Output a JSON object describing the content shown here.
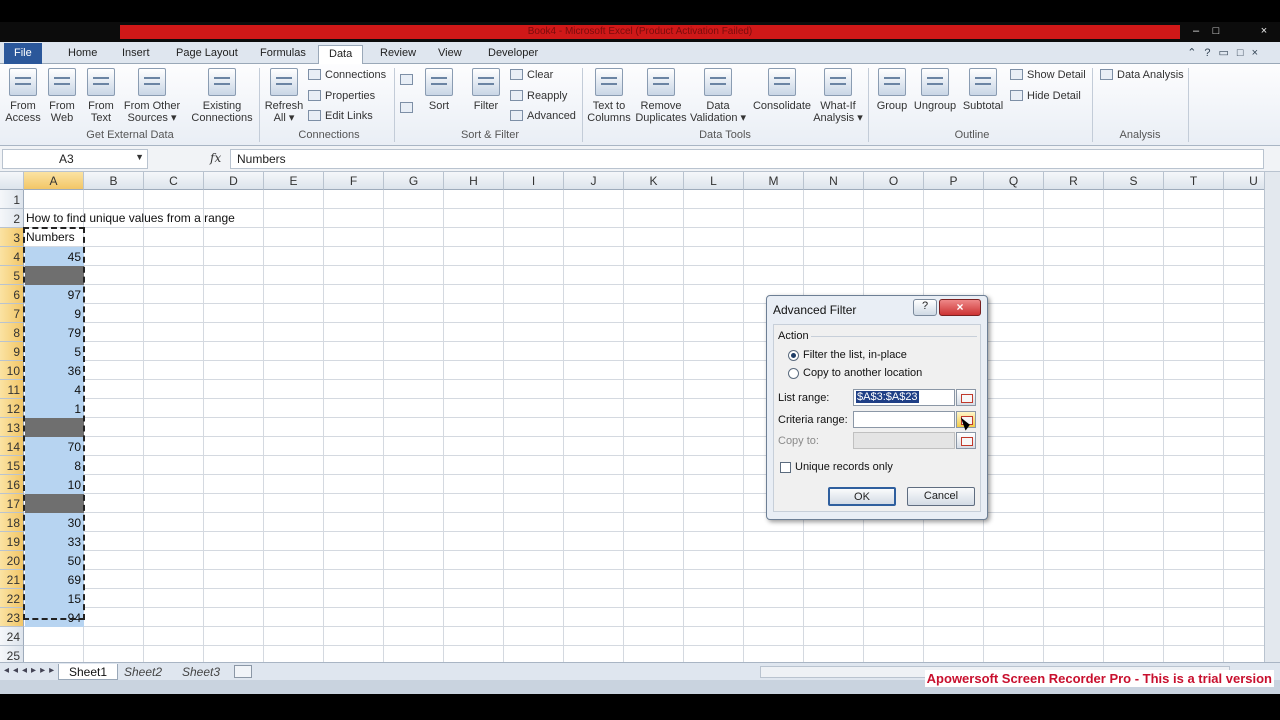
{
  "window": {
    "title": "Book4 - Microsoft Excel (Product Activation Failed)",
    "controls": [
      "–",
      "□",
      "×"
    ]
  },
  "ribbon_tabs": [
    "File",
    "Home",
    "Insert",
    "Page Layout",
    "Formulas",
    "Data",
    "Review",
    "View",
    "Developer"
  ],
  "active_tab": "Data",
  "ribbon": {
    "get_external_data": {
      "label": "Get External Data",
      "from_access": [
        "From",
        "Access"
      ],
      "from_web": [
        "From",
        "Web"
      ],
      "from_text": [
        "From",
        "Text"
      ],
      "from_other": [
        "From Other",
        "Sources ▾"
      ],
      "existing": [
        "Existing",
        "Connections"
      ]
    },
    "connections": {
      "label": "Connections",
      "refresh": [
        "Refresh",
        "All ▾"
      ],
      "items": [
        "Connections",
        "Properties",
        "Edit Links"
      ]
    },
    "sort_filter": {
      "label": "Sort & Filter",
      "sort": "Sort",
      "filter": "Filter",
      "items": [
        "Clear",
        "Reapply",
        "Advanced"
      ]
    },
    "data_tools": {
      "label": "Data Tools",
      "text_to_columns": [
        "Text to",
        "Columns"
      ],
      "remove_duplicates": [
        "Remove",
        "Duplicates"
      ],
      "data_validation": [
        "Data",
        "Validation ▾"
      ],
      "consolidate": "Consolidate",
      "what_if": [
        "What-If",
        "Analysis ▾"
      ]
    },
    "outline": {
      "label": "Outline",
      "group": "Group",
      "ungroup": "Ungroup",
      "subtotal": "Subtotal",
      "items": [
        "Show Detail",
        "Hide Detail"
      ]
    },
    "analysis": {
      "label": "Analysis",
      "data_analysis": "Data Analysis"
    }
  },
  "formula_bar": {
    "name_box": "A3",
    "fx": "fx",
    "content": "Numbers"
  },
  "columns": [
    "A",
    "B",
    "C",
    "D",
    "E",
    "F",
    "G",
    "H",
    "I",
    "J",
    "K",
    "L",
    "M",
    "N",
    "O",
    "P",
    "Q",
    "R",
    "S",
    "T",
    "U"
  ],
  "rows": [
    "1",
    "2",
    "3",
    "4",
    "5",
    "6",
    "7",
    "8",
    "9",
    "10",
    "11",
    "12",
    "13",
    "14",
    "15",
    "16",
    "17",
    "18",
    "19",
    "20",
    "21",
    "22",
    "23",
    "24",
    "25"
  ],
  "cells": {
    "a2": "How to find unique values from a range",
    "a3": "Numbers",
    "values": [
      "45",
      "",
      "97",
      "9",
      "79",
      "5",
      "36",
      "4",
      "1",
      "",
      "70",
      "8",
      "10",
      "",
      "30",
      "33",
      "50",
      "69",
      "15",
      "94"
    ]
  },
  "sheet_tabs": [
    "Sheet1",
    "Sheet2",
    "Sheet3"
  ],
  "watermark": "Apowersoft Screen Recorder Pro - This is a trial version",
  "dialog": {
    "title": "Advanced Filter",
    "help": "?",
    "close": "×",
    "action_label": "Action",
    "radio_filter": "Filter the list, in-place",
    "radio_copy": "Copy to another location",
    "list_range_label": "List range:",
    "list_range_value": "$A$3:$A$23",
    "criteria_label": "Criteria range:",
    "criteria_value": "",
    "copy_to_label": "Copy to:",
    "unique_label": "Unique records only",
    "ok": "OK",
    "cancel": "Cancel"
  }
}
